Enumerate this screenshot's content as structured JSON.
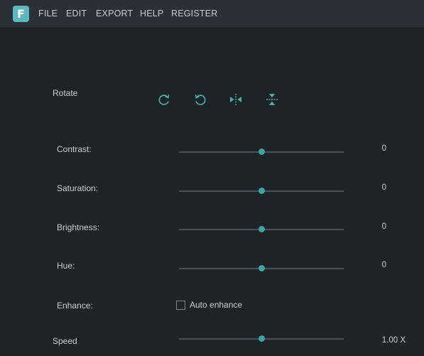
{
  "app": {
    "logo_letter": "F",
    "accent_color": "#3fa59f"
  },
  "menu": {
    "items": [
      "FILE",
      "EDIT",
      "EXPORT",
      "HELP",
      "REGISTER"
    ]
  },
  "rotate": {
    "label": "Rotate",
    "buttons": [
      {
        "icon": "rotate-clockwise-icon"
      },
      {
        "icon": "rotate-counterclockwise-icon"
      },
      {
        "icon": "flip-horizontal-icon"
      },
      {
        "icon": "flip-vertical-icon"
      }
    ]
  },
  "adjustments": [
    {
      "label": "Contrast:",
      "value": "0",
      "level": 0.5
    },
    {
      "label": "Saturation:",
      "value": "0",
      "level": 0.5
    },
    {
      "label": "Brightness:",
      "value": "0",
      "level": 0.5
    },
    {
      "label": "Hue:",
      "value": "0",
      "level": 0.5
    }
  ],
  "enhance": {
    "label": "Enhance:",
    "checkbox_label": "Auto enhance",
    "checked": false
  },
  "speed": {
    "label": "Speed",
    "value": "1.00 X",
    "level": 0.5
  }
}
